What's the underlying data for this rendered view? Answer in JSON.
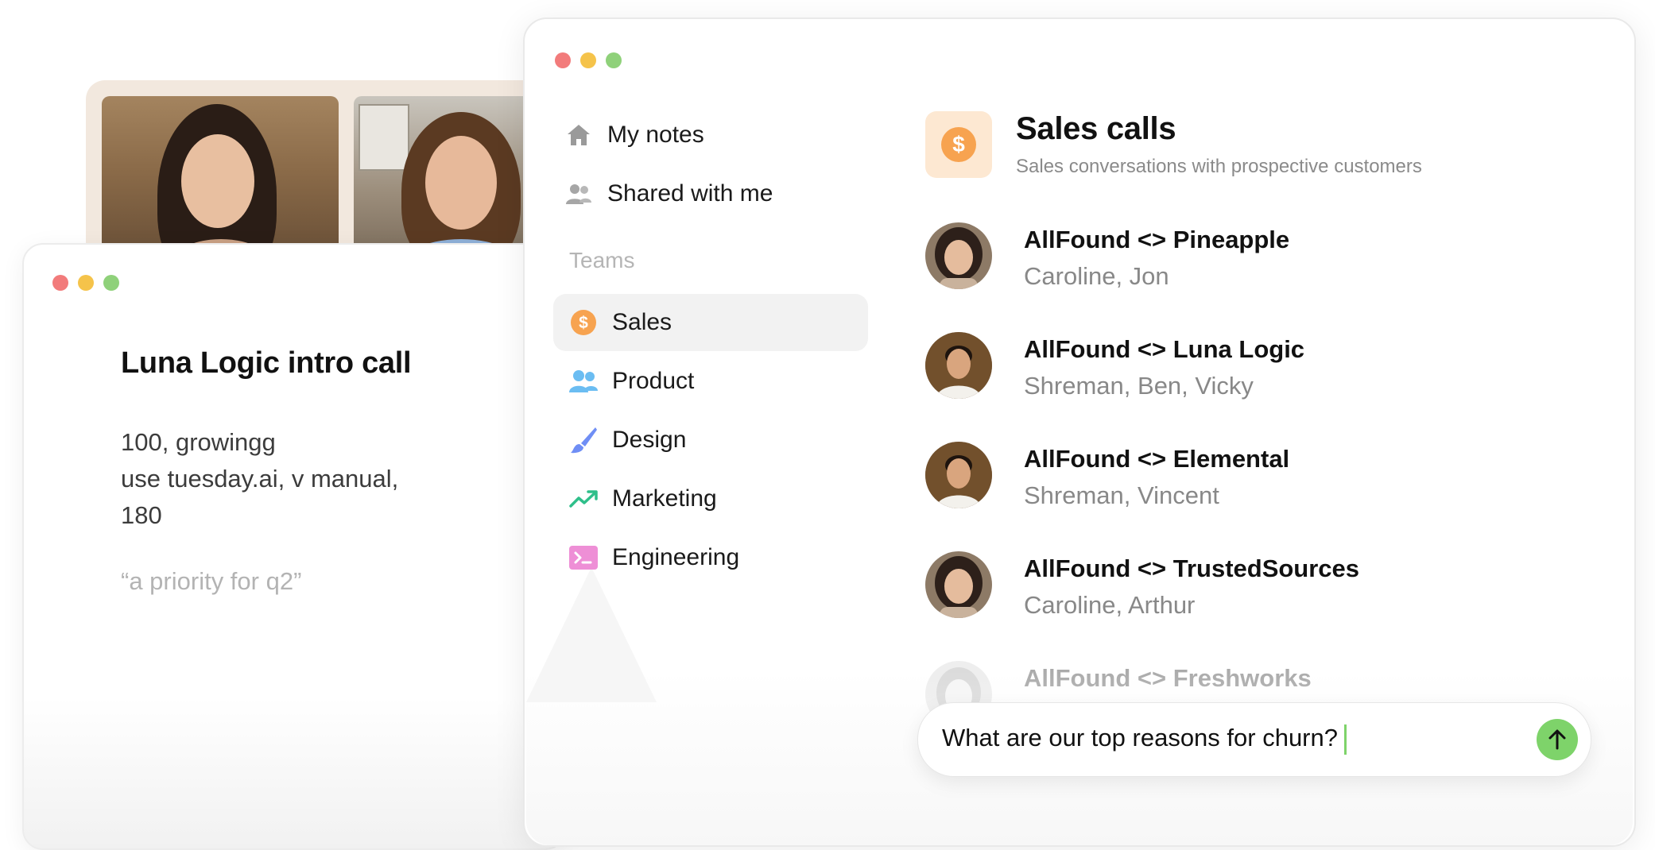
{
  "video_call": {
    "participants": [
      "participant-woman",
      "participant-man"
    ]
  },
  "note": {
    "title": "Luna Logic intro call",
    "lines": [
      "100, growingg",
      "use tuesday.ai, v manual,",
      "180"
    ],
    "quote": "“a priority for q2”"
  },
  "sidebar": {
    "my_notes": "My notes",
    "shared": "Shared with me",
    "section_label": "Teams",
    "teams": [
      {
        "label": "Sales",
        "icon": "dollar-icon",
        "color": "#f7a350"
      },
      {
        "label": "Product",
        "icon": "people-icon",
        "color": "#6bbdf2"
      },
      {
        "label": "Design",
        "icon": "paintbrush-icon",
        "color": "#6f8ef5"
      },
      {
        "label": "Marketing",
        "icon": "trend-up-icon",
        "color": "#2fbf8a"
      },
      {
        "label": "Engineering",
        "icon": "terminal-icon",
        "color": "#ee8fd6"
      }
    ]
  },
  "main": {
    "title": "Sales calls",
    "subtitle": "Sales conversations with prospective customers",
    "calls": [
      {
        "title": "AllFound <> Pineapple",
        "people": "Caroline, Jon"
      },
      {
        "title": "AllFound <> Luna Logic",
        "people": "Shreman, Ben, Vicky"
      },
      {
        "title": "AllFound <> Elemental",
        "people": "Shreman, Vincent"
      },
      {
        "title": "AllFound <> TrustedSources",
        "people": "Caroline, Arthur"
      },
      {
        "title": "AllFound <> Freshworks",
        "people": ""
      }
    ]
  },
  "chat": {
    "value": "What are our top reasons for churn?"
  },
  "colors": {
    "accent_green": "#7ed36a",
    "sales_orange": "#f7a350",
    "traffic_red": "#f27b7b",
    "traffic_yellow": "#f5c34a",
    "traffic_green": "#8fd17a"
  }
}
